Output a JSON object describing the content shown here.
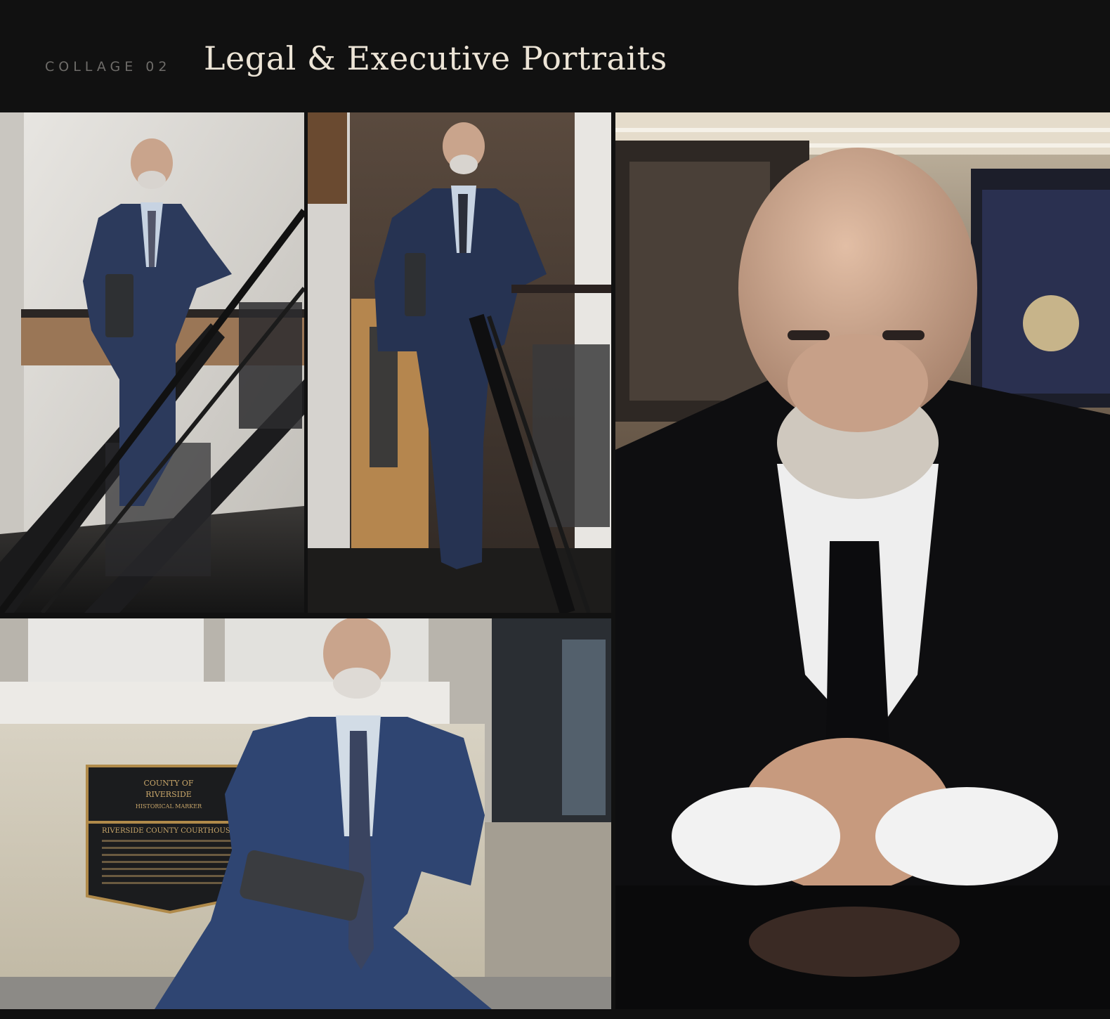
{
  "header": {
    "eyebrow": "COLLAGE 02",
    "title": "Legal & Executive Portraits"
  },
  "photos": [
    {
      "subject": "man in navy suit leaning on stair railing holding tablet"
    },
    {
      "subject": "man in navy suit standing at top of stairs with tablet"
    },
    {
      "subject": "man in blue suit sitting on courthouse steps holding tablet"
    },
    {
      "subject": "close-up portrait of man in black suit with clasped hands"
    }
  ],
  "plaque": {
    "line1": "COUNTY OF",
    "line2": "RIVERSIDE",
    "line3": "HISTORICAL MARKER",
    "heading": "RIVERSIDE COUNTY COURTHOUSE"
  },
  "colors": {
    "background": "#111111",
    "title": "#ece4d6",
    "eyebrow": "#6e6c69",
    "navy_suit": "#2c3a5c",
    "black_suit": "#0e0e10"
  }
}
